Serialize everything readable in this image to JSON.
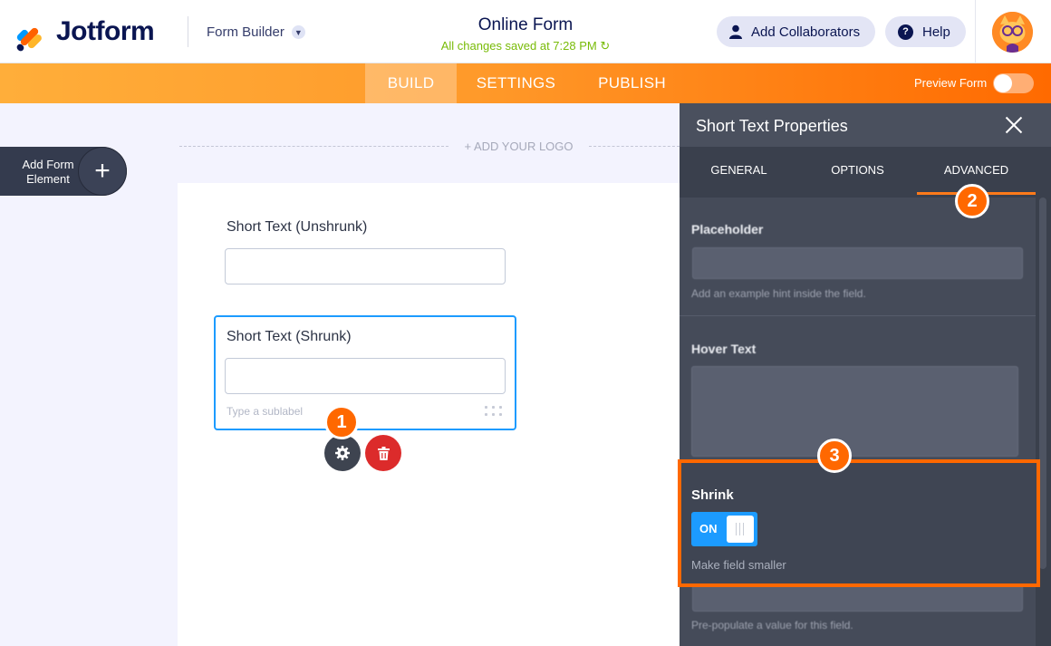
{
  "header": {
    "logo_text": "Jotform",
    "builder_menu": "Form Builder",
    "form_title": "Online Form",
    "save_status": "All changes saved at 7:28 PM",
    "collaborators_button": "Add Collaborators",
    "help_button": "Help"
  },
  "navbar": {
    "tabs": [
      {
        "label": "BUILD",
        "active": true
      },
      {
        "label": "SETTINGS",
        "active": false
      },
      {
        "label": "PUBLISH",
        "active": false
      }
    ],
    "preview_label": "Preview Form"
  },
  "canvas": {
    "add_element_label": "Add Form Element",
    "add_logo": "+ ADD YOUR LOGO",
    "fields": [
      {
        "label": "Short Text (Unshrunk)"
      },
      {
        "label": "Short Text (Shrunk)",
        "sublabel_placeholder": "Type a sublabel"
      }
    ]
  },
  "panel": {
    "title": "Short Text Properties",
    "tabs": [
      "GENERAL",
      "OPTIONS",
      "ADVANCED"
    ],
    "active_tab": "ADVANCED",
    "placeholder_label": "Placeholder",
    "placeholder_help": "Add an example hint inside the field.",
    "hover_label": "Hover Text",
    "shrink_label": "Shrink",
    "shrink_state": "ON",
    "shrink_help": "Make field smaller",
    "default_help": "Pre-populate a value for this field."
  },
  "annotations": [
    "1",
    "2",
    "3"
  ],
  "colors": {
    "brand_navy": "#0a1551",
    "accent_orange": "#ff6800",
    "toggle_blue": "#1c9bff",
    "delete_red": "#dc2b2b",
    "saved_green": "#78bb07"
  },
  "icons": {
    "gear": "gear-icon",
    "delete": "trash-icon",
    "close": "close-icon",
    "user": "user-icon",
    "help": "help-icon",
    "refresh": "refresh-icon"
  }
}
